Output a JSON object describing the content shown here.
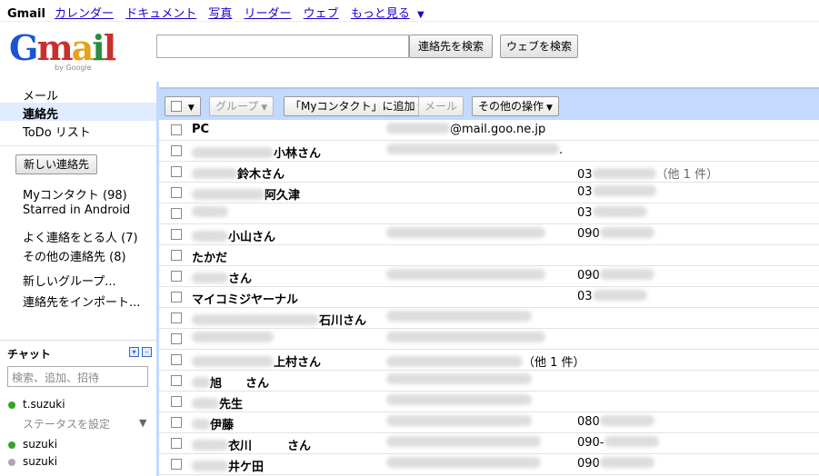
{
  "topnav": {
    "brand": "Gmail",
    "links": [
      "カレンダー",
      "ドキュメント",
      "写真",
      "リーダー",
      "ウェブ",
      "もっと見る"
    ],
    "more_arrow": "▼"
  },
  "logo": {
    "word": "Gmail",
    "by": "by Google"
  },
  "search": {
    "contact_search_label": "連絡先を検索",
    "web_search_label": "ウェブを検索"
  },
  "leftnav": {
    "items": [
      {
        "label": "メール"
      },
      {
        "label": "連絡先"
      },
      {
        "label": "ToDo リスト"
      }
    ],
    "new_contact_label": "新しい連絡先",
    "my_contacts": "Myコンタクト (98)",
    "starred_android": "Starred in Android",
    "frequent": "よく連絡をとる人 (7)",
    "other_contacts": "その他の連絡先 (8)",
    "new_group": "新しいグループ...",
    "import": "連絡先をインポート..."
  },
  "chat": {
    "title": "チャット",
    "search_placeholder": "検索、追加、招待",
    "me": "t.suzuki",
    "status_label": "ステータスを設定",
    "status_arrow": "▼",
    "contacts": [
      "suzuki",
      "suzuki"
    ],
    "colors": {
      "online": "#35a52a",
      "offline": "#aaaaaa"
    }
  },
  "toolbar": {
    "select_arrow": "▼",
    "group_label": "グループ",
    "add_mycontacts_label": "「Myコンタクト」に追加",
    "mail_label": "メール",
    "more_actions_label": "その他の操作",
    "arrow": "▼"
  },
  "contacts": [
    {
      "name": "PC",
      "email": "@mail.goo.ne.jp",
      "phone": ""
    },
    {
      "name": "小林さん",
      "email": ".",
      "phone": ""
    },
    {
      "name": "鈴木さん",
      "email": "",
      "phone": "03",
      "phone_extra": "（他 1 件）"
    },
    {
      "name": "阿久津",
      "email": "",
      "phone": "03"
    },
    {
      "name": "",
      "email": "",
      "phone": "03"
    },
    {
      "name": "小山さん",
      "email": "",
      "phone": "090"
    },
    {
      "name": "たかだ",
      "email": "",
      "phone": ""
    },
    {
      "name": "さん",
      "email": "",
      "phone": "090"
    },
    {
      "name": "マイコミジヤーナル",
      "email": "",
      "phone": "03"
    },
    {
      "name": "石川さん",
      "email": "",
      "phone": ""
    },
    {
      "name": "",
      "email": "",
      "phone": ""
    },
    {
      "name": "上村さん",
      "email": "（他 1 件）",
      "phone": ""
    },
    {
      "name": "旭　　さん",
      "email": "",
      "phone": ""
    },
    {
      "name": "先生",
      "email": "",
      "phone": ""
    },
    {
      "name": "伊藤",
      "email": "",
      "phone": "080"
    },
    {
      "name": "衣川　　　さん",
      "email": "",
      "phone": "090-"
    },
    {
      "name": "井ケ田",
      "email": "",
      "phone": "090"
    }
  ]
}
